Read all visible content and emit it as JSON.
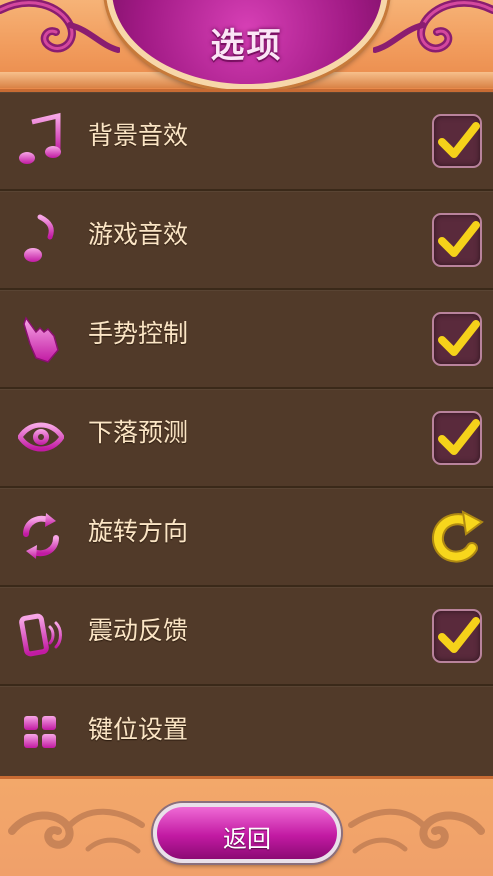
{
  "header": {
    "title": "选项"
  },
  "options": [
    {
      "label": "背景音效",
      "icon": "music-notes-icon",
      "control": "checkbox",
      "checked": true
    },
    {
      "label": "游戏音效",
      "icon": "music-note-icon",
      "control": "checkbox",
      "checked": true
    },
    {
      "label": "手势控制",
      "icon": "pointing-hand-icon",
      "control": "checkbox",
      "checked": true
    },
    {
      "label": "下落预测",
      "icon": "eye-icon",
      "control": "checkbox",
      "checked": true
    },
    {
      "label": "旋转方向",
      "icon": "rotate-arrows-icon",
      "control": "rotate-button"
    },
    {
      "label": "震动反馈",
      "icon": "vibrate-phone-icon",
      "control": "checkbox",
      "checked": true
    },
    {
      "label": "键位设置",
      "icon": "grid-keys-icon",
      "control": "none"
    }
  ],
  "footer": {
    "back_label": "返回"
  },
  "colors": {
    "accent_pink": "#c21aa3",
    "check_yellow": "#f5d21a",
    "panel_brown": "#513a29",
    "frame_orange": "#f19b5c"
  }
}
